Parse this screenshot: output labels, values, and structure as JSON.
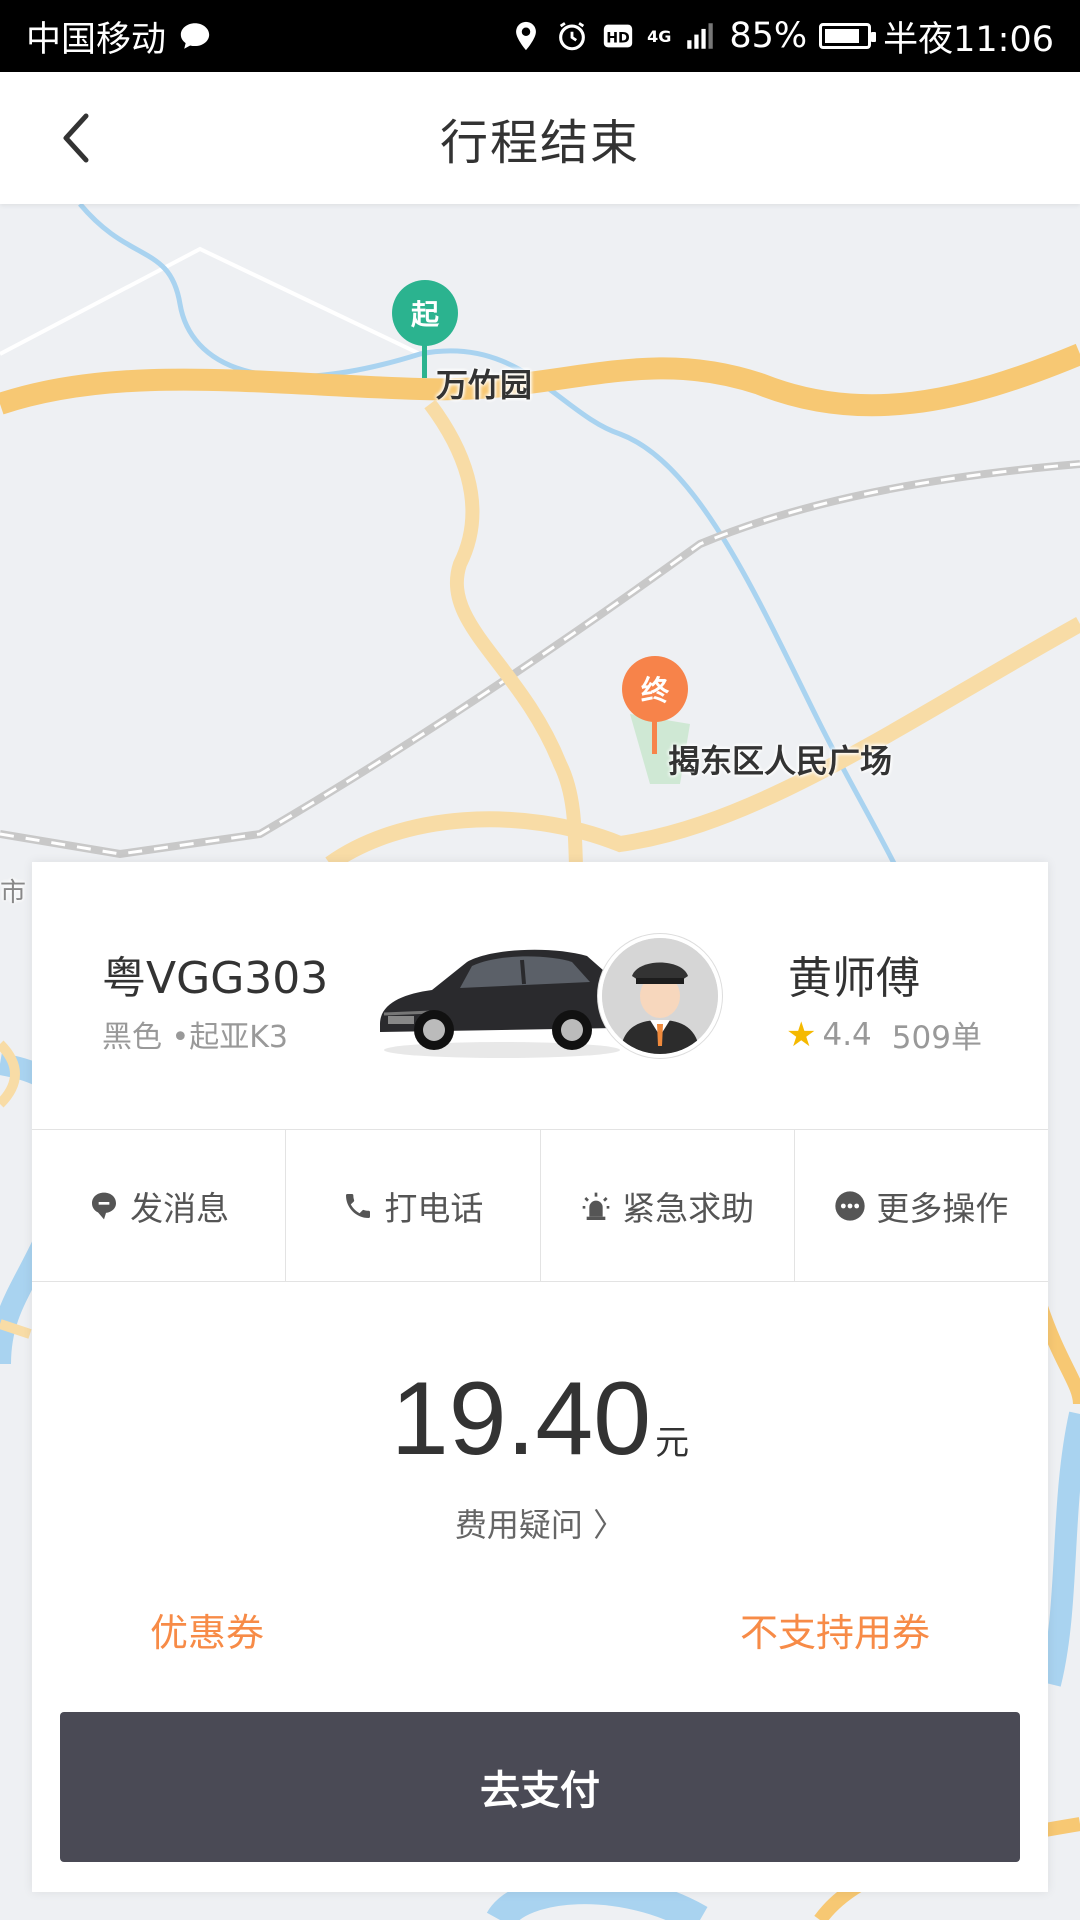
{
  "status_bar": {
    "carrier": "中国移动",
    "network": "4G",
    "battery": "85%",
    "battery_level": 0.85,
    "time": "半夜11:06"
  },
  "header": {
    "back_icon": "chevron-left-icon",
    "title": "行程结束"
  },
  "map": {
    "start_pin": "起",
    "start_label": "万竹园",
    "end_pin": "终",
    "end_label": "揭东区人民广场",
    "edge_label": "市",
    "colors": {
      "start": "#2bb38f",
      "end": "#f7834a",
      "road": "#f7c873",
      "river": "#a9d3f0"
    }
  },
  "driver": {
    "plate": "粤VGG303",
    "car_desc": "黑色 •起亚K3",
    "name": "黄师傅",
    "rating": "4.4",
    "orders": "509单"
  },
  "actions": [
    {
      "label": "发消息",
      "icon": "message-icon"
    },
    {
      "label": "打电话",
      "icon": "phone-icon"
    },
    {
      "label": "紧急求助",
      "icon": "alarm-icon"
    },
    {
      "label": "更多操作",
      "icon": "more-icon"
    }
  ],
  "fare": {
    "amount": "19.40",
    "unit": "元",
    "question": "费用疑问 〉",
    "coupon_label": "优惠券",
    "coupon_status": "不支持用券",
    "pay_button": "去支付"
  },
  "colors": {
    "accent": "#f78b47",
    "pay_button": "#4a4a55",
    "star": "#f5b900"
  }
}
